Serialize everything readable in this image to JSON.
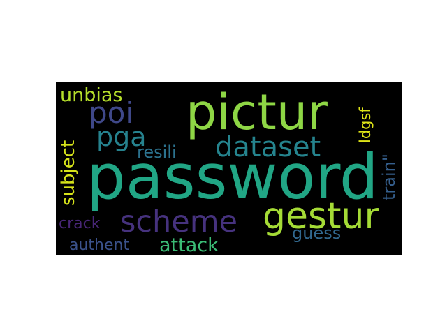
{
  "wordcloud": {
    "words": [
      {
        "text": "password",
        "color": "#21a685"
      },
      {
        "text": "pictur",
        "color": "#8ed645"
      },
      {
        "text": "gestur",
        "color": "#a5db36"
      },
      {
        "text": "scheme",
        "color": "#46327e"
      },
      {
        "text": "dataset",
        "color": "#25848e"
      },
      {
        "text": "poi",
        "color": "#3f4889"
      },
      {
        "text": "pga",
        "color": "#26828e"
      },
      {
        "text": "attack",
        "color": "#3bbb75"
      },
      {
        "text": "unbias",
        "color": "#b5de2b"
      },
      {
        "text": "subject",
        "color": "#d5e21a"
      },
      {
        "text": "train\"",
        "color": "#355f8d"
      },
      {
        "text": "ldgsf",
        "color": "#dde318"
      },
      {
        "text": "resili",
        "color": "#2c728e"
      },
      {
        "text": "guess",
        "color": "#31688e"
      },
      {
        "text": "crack",
        "color": "#482677"
      },
      {
        "text": "authent",
        "color": "#3b528b"
      }
    ]
  }
}
